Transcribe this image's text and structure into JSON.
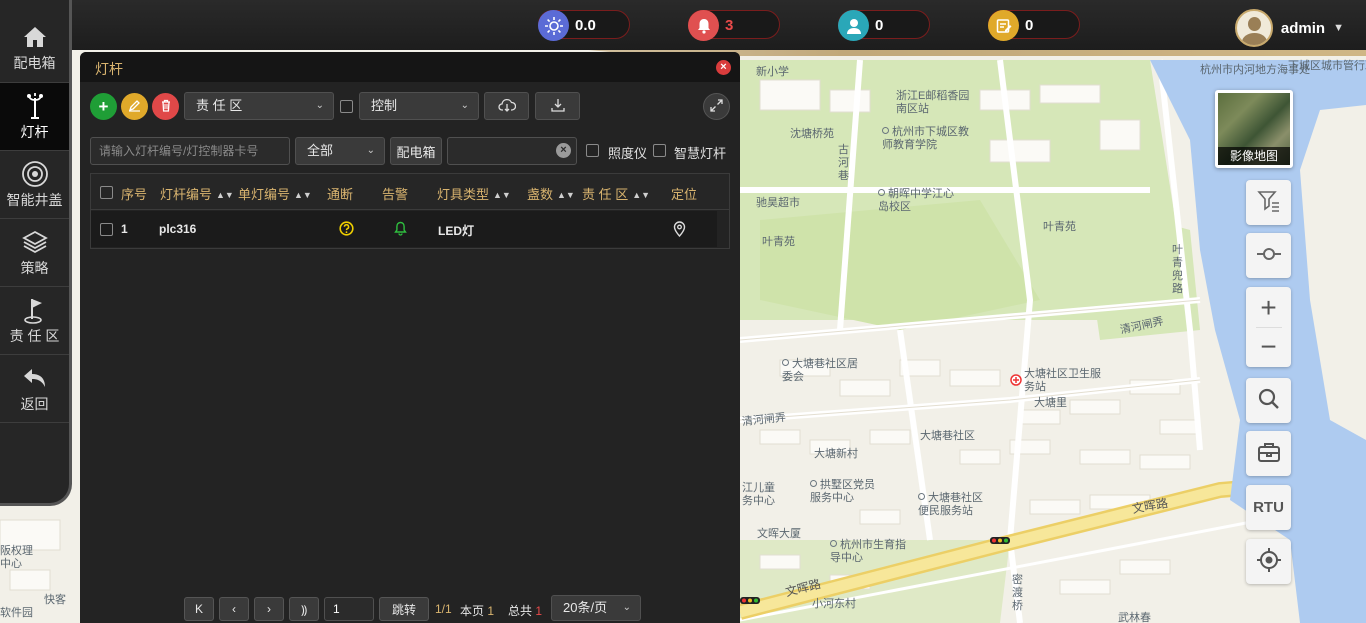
{
  "topbar": {
    "stats": [
      {
        "name": "lighting",
        "value": "0.0",
        "color": "#5b6bd6"
      },
      {
        "name": "alarm",
        "value": "3",
        "color": "#e05050"
      },
      {
        "name": "user",
        "value": "0",
        "color": "#2aa7b8"
      },
      {
        "name": "task",
        "value": "0",
        "color": "#e0a92a"
      }
    ],
    "username": "admin"
  },
  "sidebar": {
    "items": [
      {
        "label": "配电箱",
        "icon": "home-icon"
      },
      {
        "label": "灯杆",
        "icon": "lamp-pole-icon",
        "active": true
      },
      {
        "label": "智能井盖",
        "icon": "manhole-icon"
      },
      {
        "label": "策略",
        "icon": "layers-icon"
      },
      {
        "label": "责 任 区",
        "icon": "flag-icon"
      },
      {
        "label": "返回",
        "icon": "back-icon"
      }
    ]
  },
  "panel": {
    "title": "灯杆",
    "toolbar": {
      "zone_select": "责 任 区",
      "control_select": "控制"
    },
    "filters": {
      "search_placeholder": "请输入灯杆编号/灯控制器卡号",
      "status_select": "全部",
      "box_button": "配电箱",
      "box_input": "",
      "illuminometer_label": "照度仪",
      "smart_pole_label": "智慧灯杆"
    },
    "table": {
      "headers": {
        "index": "序号",
        "pole_no": "灯杆编号",
        "single_no": "单灯编号",
        "online": "通断",
        "alarm": "告警",
        "lamp_type": "灯具类型",
        "count": "盏数",
        "zone": "责 任 区",
        "locate": "定位"
      },
      "rows": [
        {
          "index": "1",
          "pole_no": "plc316",
          "single_no": "",
          "online": "unknown",
          "alarm": "normal",
          "lamp_type": "LED灯",
          "count": "",
          "zone": ""
        }
      ]
    },
    "pagination": {
      "page_input": "1",
      "jump_label": "跳转",
      "page_info": "1/1",
      "this_page_label": "本页",
      "this_page_count": "1",
      "total_label": "总共",
      "total_count": "1",
      "page_size": "20条/页"
    }
  },
  "map": {
    "labels": [
      "杭州市内河地方海事处",
      "下城区城市管行政执法局",
      "浙江E邮稻香园南区站",
      "杭州市下城区教师教育学院",
      "沈塘桥苑",
      "古河巷",
      "朝晖中学江心岛校区",
      "驰昊超市",
      "叶青苑",
      "叶青苑",
      "叶青兜路",
      "清河闸弄",
      "大塘巷社区居委会",
      "大塘社区卫生服务站",
      "大塘里",
      "清河闸弄",
      "大塘巷社区",
      "大塘新村",
      "拱墅区党员服务中心",
      "大塘巷社区便民服务站",
      "文晖路",
      "文晖路",
      "文晖大厦",
      "杭州市生育指导中心",
      "小河东村",
      "密渡桥",
      "武林春",
      "江儿童务中心",
      "阪权理中心",
      "软件园",
      "快客",
      "新小学"
    ],
    "image_map_label": "影像地图",
    "rtu_label": "RTU"
  }
}
